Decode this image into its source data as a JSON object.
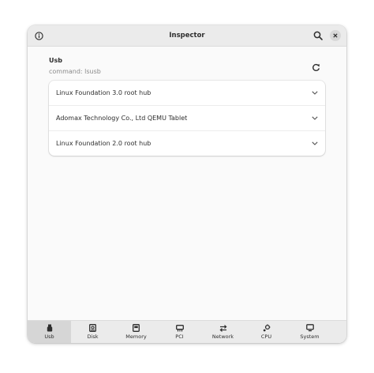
{
  "header": {
    "title": "Inspector",
    "about_icon": "info-circle-icon",
    "search_icon": "search-icon",
    "close_icon": "close-icon"
  },
  "section": {
    "title": "Usb",
    "subtitle": "command: lsusb",
    "refresh_icon": "refresh-icon"
  },
  "devices": [
    {
      "label": "Linux Foundation 3.0 root hub"
    },
    {
      "label": "Adomax Technology Co., Ltd QEMU Tablet"
    },
    {
      "label": "Linux Foundation 2.0 root hub"
    }
  ],
  "tabs": [
    {
      "label": "Usb",
      "icon": "usb-icon",
      "active": true
    },
    {
      "label": "Disk",
      "icon": "disk-icon",
      "active": false
    },
    {
      "label": "Memory",
      "icon": "memory-icon",
      "active": false
    },
    {
      "label": "PCI",
      "icon": "pci-icon",
      "active": false
    },
    {
      "label": "Network",
      "icon": "network-icon",
      "active": false
    },
    {
      "label": "CPU",
      "icon": "cpu-icon",
      "active": false
    },
    {
      "label": "System",
      "icon": "system-icon",
      "active": false
    }
  ],
  "colors": {
    "headerbar": "#ebebeb",
    "content": "#fafafa",
    "active_tab": "#d6d6d6",
    "text": "#2e2e2e",
    "subtext": "#8a8a8a"
  }
}
